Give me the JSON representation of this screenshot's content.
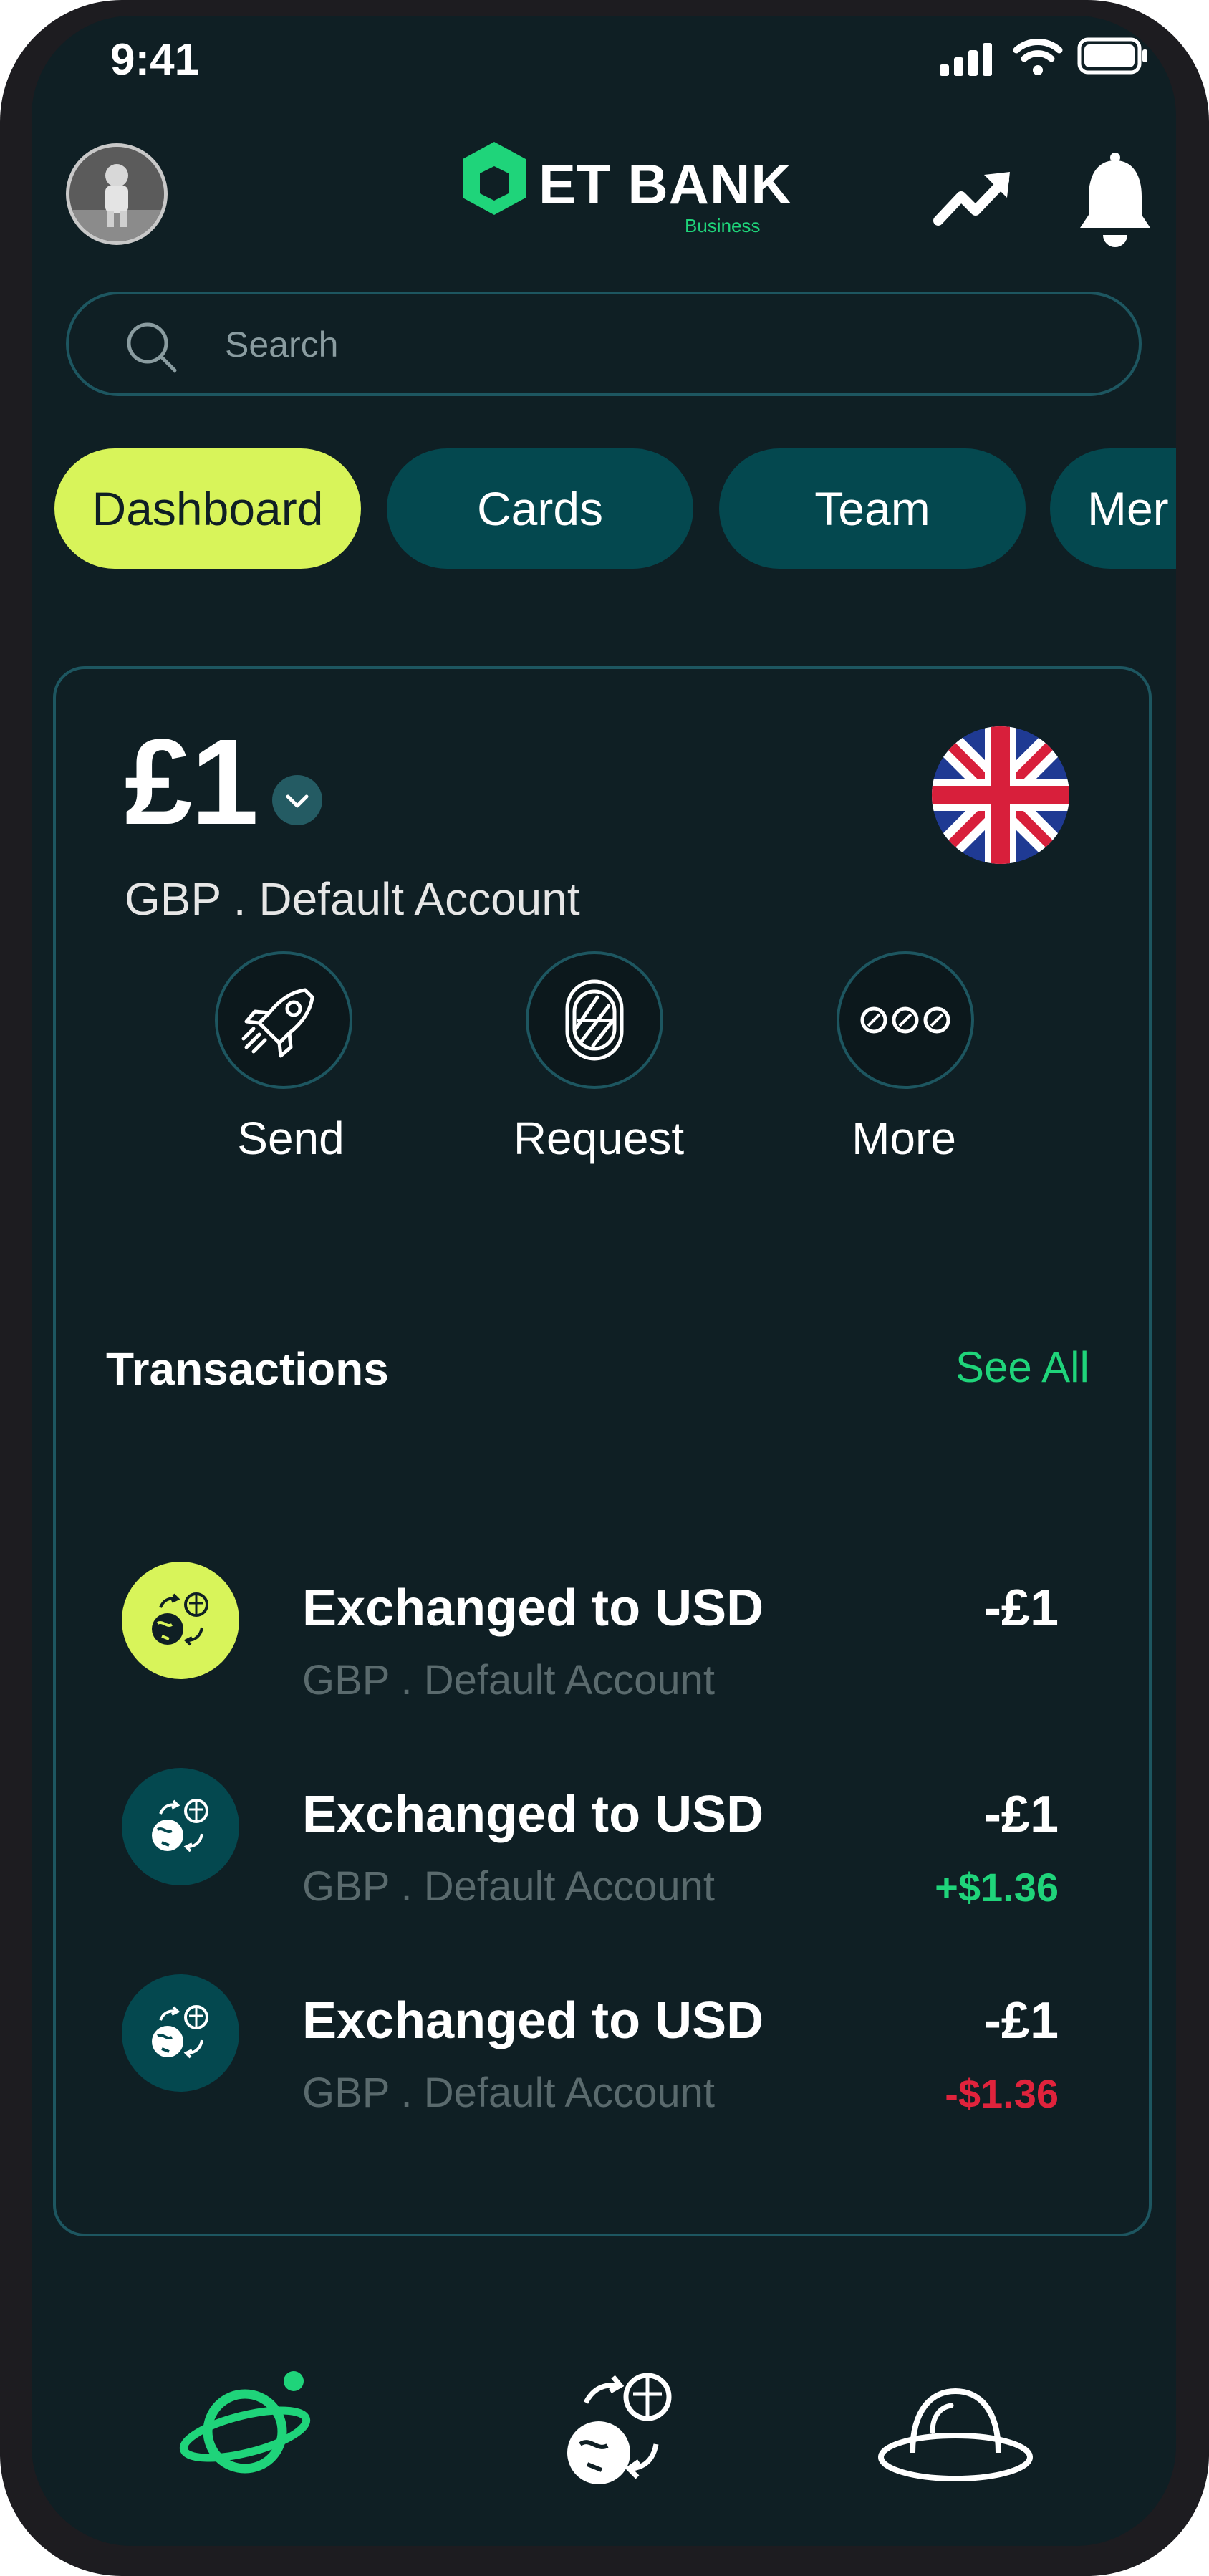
{
  "status_bar": {
    "time": "9:41"
  },
  "header": {
    "brand": "ET BANK",
    "brand_sub": "Business"
  },
  "search": {
    "placeholder": "Search"
  },
  "tabs": [
    {
      "label": "Dashboard",
      "active": true
    },
    {
      "label": "Cards"
    },
    {
      "label": "Team"
    },
    {
      "label": "Mer"
    }
  ],
  "account": {
    "balance": "£1",
    "label": "GBP . Default Account"
  },
  "actions": [
    {
      "label": "Send",
      "icon": "rocket-icon"
    },
    {
      "label": "Request",
      "icon": "window-icon"
    },
    {
      "label": "More",
      "icon": "more-dots-icon"
    }
  ],
  "transactions_section": {
    "heading": "Transactions",
    "see_all": "See All"
  },
  "transactions": [
    {
      "title": "Exchanged to USD",
      "subtitle": "GBP . Default Account",
      "amount": "-£1",
      "converted": "",
      "icon": "exchange-globe-icon"
    },
    {
      "title": "Exchanged to USD",
      "subtitle": "GBP . Default Account",
      "amount": "-£1",
      "converted": "+$1.36",
      "icon": "exchange-globe-icon"
    },
    {
      "title": "Exchanged to USD",
      "subtitle": "GBP . Default Account",
      "amount": "-£1",
      "converted": "-$1.36",
      "icon": "exchange-globe-icon"
    }
  ],
  "colors": {
    "background": "#0f1f24",
    "accent_green": "#1fd47a",
    "accent_lime": "#d8f45a",
    "tab_teal": "#04484f",
    "negative_red": "#e0233c"
  },
  "bottom_nav": [
    {
      "icon": "planet-icon"
    },
    {
      "icon": "exchange-globe-icon"
    },
    {
      "icon": "ufo-hat-icon"
    }
  ]
}
